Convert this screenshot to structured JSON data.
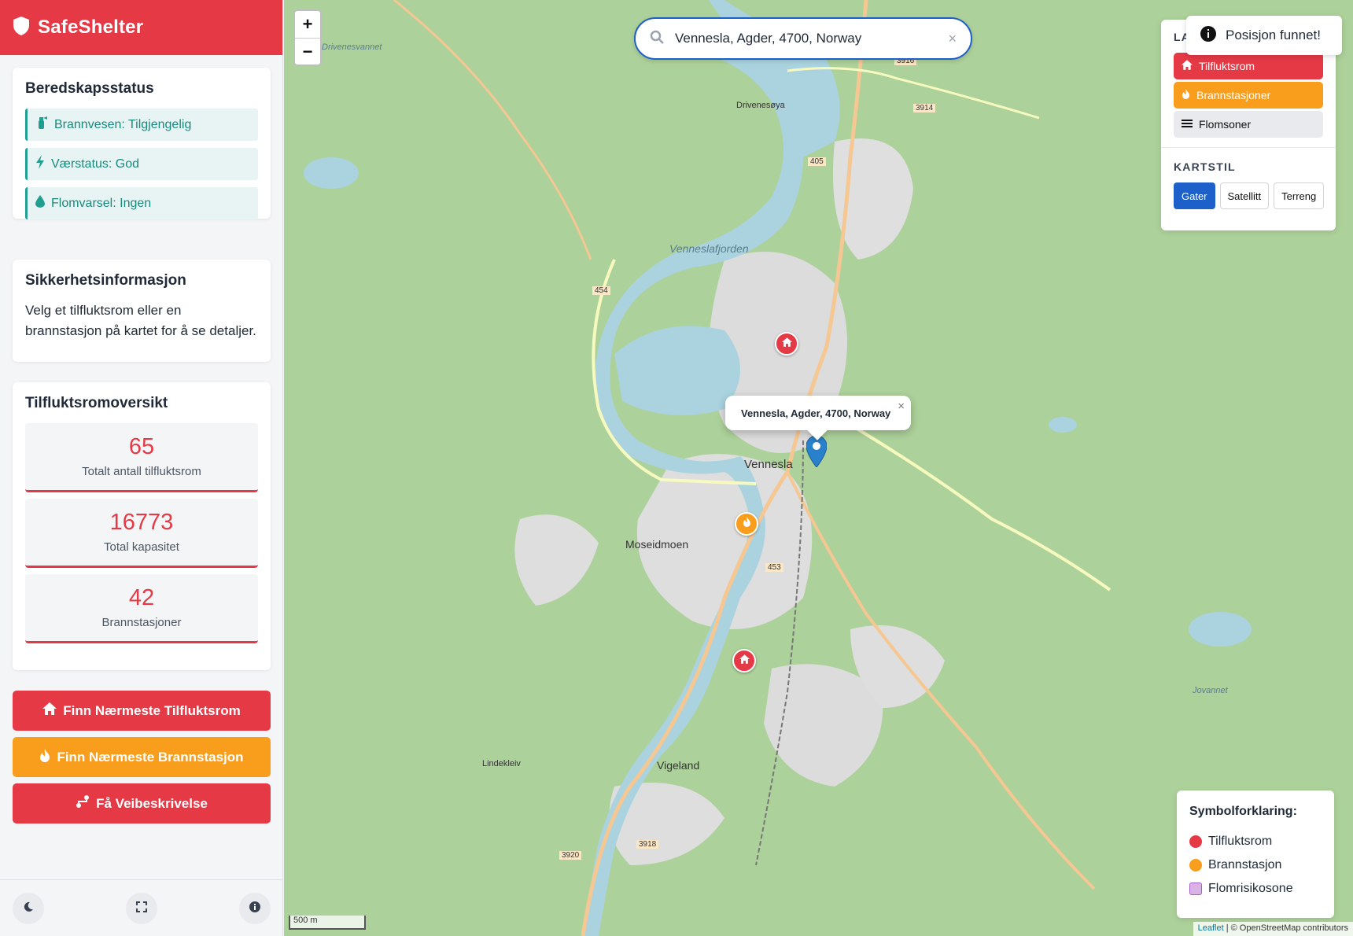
{
  "app": {
    "name": "SafeShelter"
  },
  "colors": {
    "accent": "#e63946",
    "fire": "#f99d1c",
    "teal": "#1f9e91",
    "blue": "#1e60c9"
  },
  "preparedness": {
    "title": "Beredskapsstatus",
    "items": [
      {
        "icon": "fire-extinguisher-icon",
        "label": "Brannvesen: Tilgjengelig"
      },
      {
        "icon": "bolt-icon",
        "label": "Værstatus: God"
      },
      {
        "icon": "droplet-icon",
        "label": "Flomvarsel: Ingen"
      }
    ]
  },
  "safety_info": {
    "title": "Sikkerhetsinformasjon",
    "text": "Velg et tilfluktsrom eller en brannstasjon på kartet for å se detaljer."
  },
  "overview": {
    "title": "Tilfluktsromoversikt",
    "stats": [
      {
        "value": "65",
        "label": "Totalt antall tilfluktsrom"
      },
      {
        "value": "16773",
        "label": "Total kapasitet"
      },
      {
        "value": "42",
        "label": "Brannstasjoner"
      }
    ]
  },
  "actions": {
    "nearest_shelter": "Finn Nærmeste Tilfluktsrom",
    "nearest_fire": "Finn Nærmeste Brannstasjon",
    "directions": "Få Veibeskrivelse"
  },
  "search": {
    "value": "Vennesla, Agder, 4700, Norway",
    "clear": "×"
  },
  "zoom": {
    "in": "+",
    "out": "−"
  },
  "layers": {
    "title": "LA",
    "items": [
      {
        "label": "Tilfluktsrom",
        "icon": "home-icon"
      },
      {
        "label": "Brannstasjoner",
        "icon": "fire-icon"
      },
      {
        "label": "Flomsoner",
        "icon": "water-icon"
      }
    ],
    "style_title": "KARTSTIL",
    "styles": [
      "Gater",
      "Satellitt",
      "Terreng"
    ],
    "selected_style": "Gater"
  },
  "toast": {
    "text": "Posisjon funnet!"
  },
  "popup": {
    "text": "Vennesla, Agder, 4700, Norway",
    "close": "×"
  },
  "legend": {
    "title": "Symbolforklaring:",
    "items": [
      "Tilfluktsrom",
      "Brannstasjon",
      "Flomrisikosone"
    ]
  },
  "map_labels": {
    "town": "Vennesla",
    "fjord": "Venneslafjorden",
    "moseidmoen": "Moseidmoen",
    "vigeland": "Vigeland",
    "drivenesvannet": "Drivenesvannet",
    "drivenesoya": "Drivenesøya",
    "lindekleiv": "Lindekleiv",
    "jovannet": "Jovannet",
    "r405": "405",
    "r454": "454",
    "r453": "453",
    "r3914": "3914",
    "r3916": "3916",
    "r3918": "3918",
    "r3920": "3920"
  },
  "scale": "500 m",
  "attribution": {
    "leaflet": "Leaflet",
    "rest": "| © OpenStreetMap contributors"
  }
}
